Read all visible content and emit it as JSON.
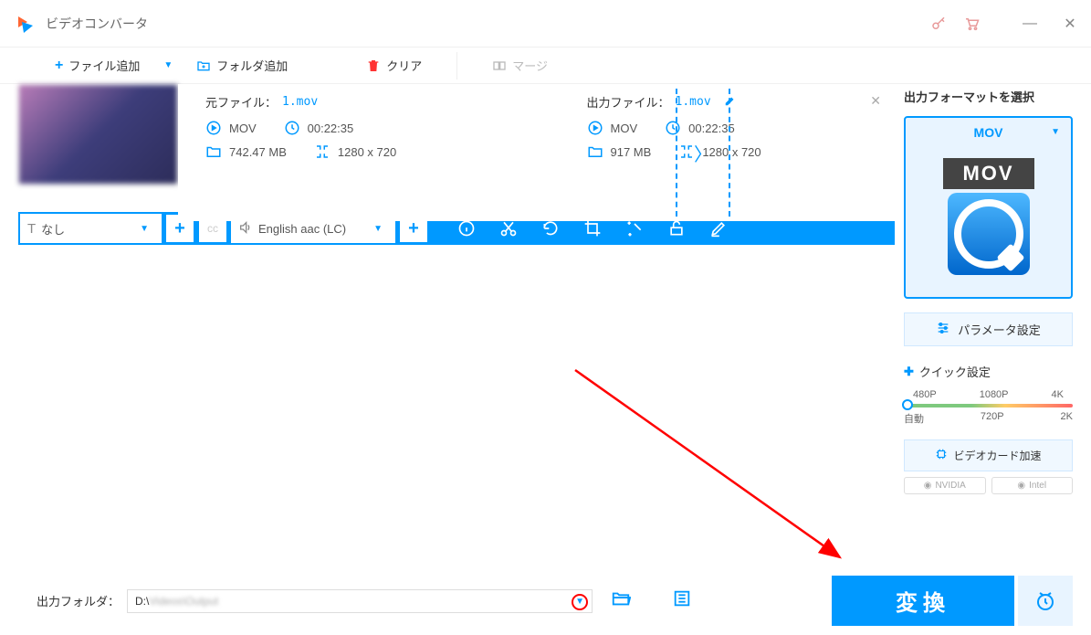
{
  "app": {
    "title": "ビデオコンバータ"
  },
  "toolbar": {
    "add_file": "ファイル追加",
    "add_folder": "フォルダ追加",
    "clear": "クリア",
    "merge": "マージ"
  },
  "file": {
    "source_label": "元ファイル：",
    "output_label": "出力ファイル：",
    "filename": "1.mov",
    "source": {
      "format": "MOV",
      "duration": "00:22:35",
      "size": "742.47 MB",
      "resolution": "1280 x 720"
    },
    "output": {
      "format": "MOV",
      "duration": "00:22:35",
      "size": "917 MB",
      "resolution": "1280 x 720"
    }
  },
  "tracks": {
    "subtitle_none": "なし",
    "audio": "English aac (LC)"
  },
  "sidebar": {
    "title": "出力フォーマットを選択",
    "format": "MOV",
    "format_badge": "MOV",
    "param_settings": "パラメータ設定",
    "quick_settings": "クイック設定",
    "slider": {
      "p480": "480P",
      "p1080": "1080P",
      "p4k": "4K",
      "auto": "自動",
      "p720": "720P",
      "p2k": "2K"
    },
    "gpu_accel": "ビデオカード加速",
    "nvidia": "NVIDIA",
    "intel": "Intel"
  },
  "bottom": {
    "output_folder_label": "出力フォルダ：",
    "output_path_prefix": "D:\\",
    "convert": "変換"
  }
}
